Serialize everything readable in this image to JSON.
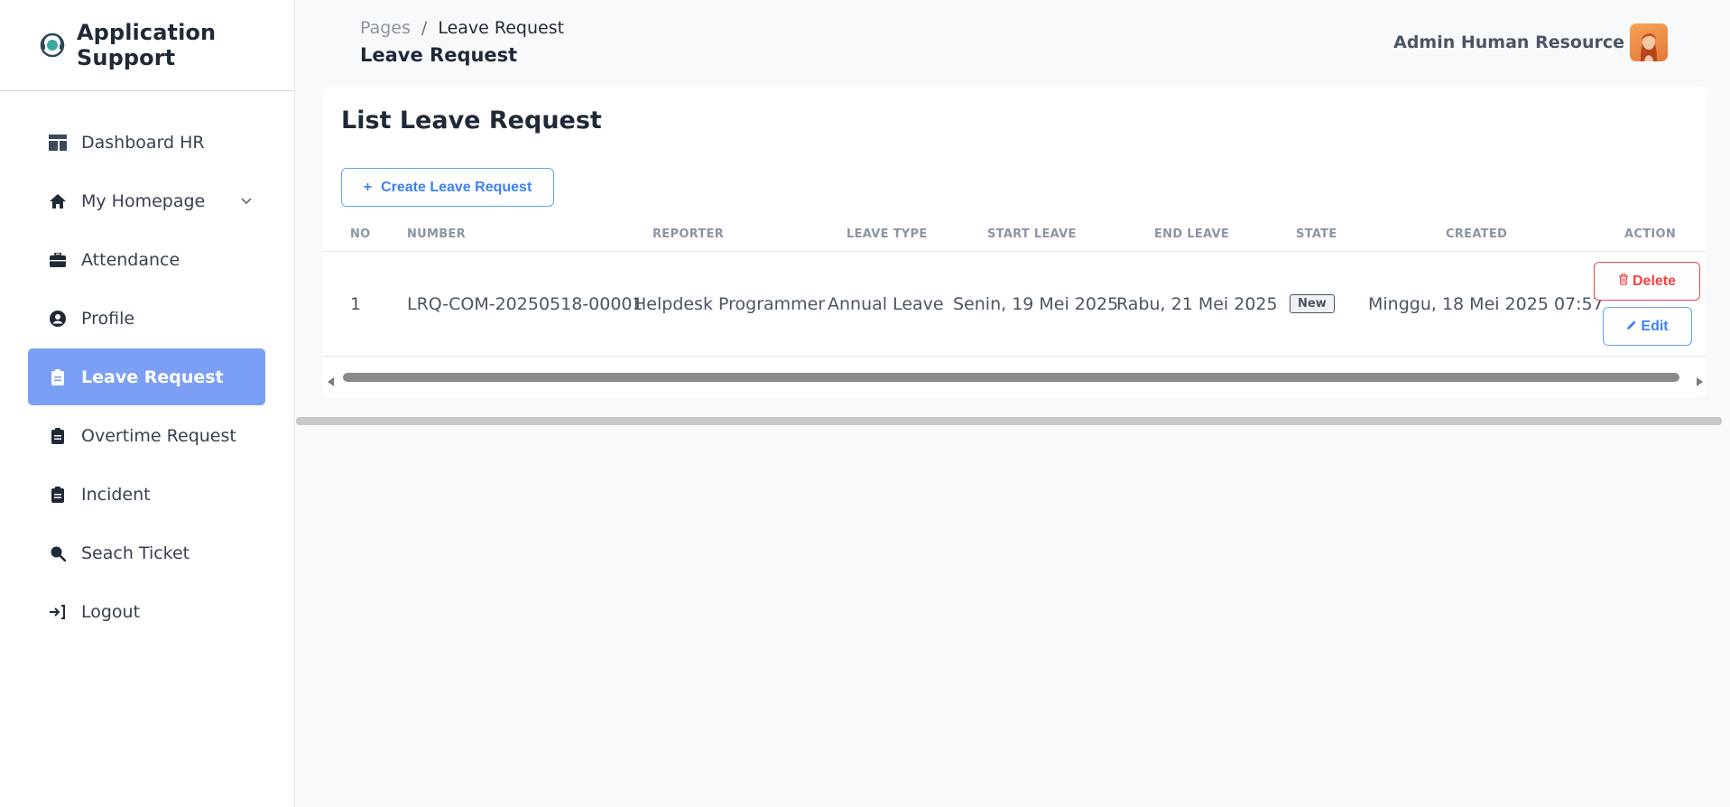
{
  "app": {
    "title": "Application Support",
    "logo_icon": "headset-support-icon"
  },
  "sidebar": {
    "items": [
      {
        "label": "Dashboard HR",
        "icon": "dashboard-icon"
      },
      {
        "label": "My Homepage",
        "icon": "home-icon",
        "has_chevron": true
      },
      {
        "label": "Attendance",
        "icon": "briefcase-icon"
      },
      {
        "label": "Profile",
        "icon": "user-circle-icon"
      },
      {
        "label": "Leave Request",
        "icon": "clipboard-icon",
        "active": true
      },
      {
        "label": "Overtime Request",
        "icon": "clipboard-icon"
      },
      {
        "label": "Incident",
        "icon": "clipboard-icon"
      },
      {
        "label": "Seach Ticket",
        "icon": "search-icon"
      },
      {
        "label": "Logout",
        "icon": "logout-icon"
      }
    ]
  },
  "header": {
    "breadcrumb_parent": "Pages",
    "breadcrumb_separator": "/",
    "breadcrumb_current": "Leave Request",
    "title": "Leave Request",
    "user_name": "Admin Human Resource"
  },
  "card": {
    "title": "List Leave Request",
    "create_button_icon": "+",
    "create_button_label": "Create Leave Request"
  },
  "table": {
    "columns": [
      "NO",
      "NUMBER",
      "REPORTER",
      "LEAVE TYPE",
      "START LEAVE",
      "END LEAVE",
      "STATE",
      "CREATED",
      "ACTION"
    ],
    "rows": [
      {
        "no": "1",
        "number": "LRQ-COM-20250518-00001",
        "reporter": "Helpdesk Programmer",
        "leave_type": "Annual Leave",
        "start_leave": "Senin, 19 Mei 2025",
        "end_leave": "Rabu, 21 Mei 2025",
        "state": "New",
        "created": "Minggu, 18 Mei 2025 07:57",
        "delete_label": "Delete",
        "edit_label": "Edit"
      }
    ]
  },
  "colors": {
    "accent": "#7b9ff5",
    "primary_button": "#3b82f6",
    "danger": "#ef4444"
  }
}
